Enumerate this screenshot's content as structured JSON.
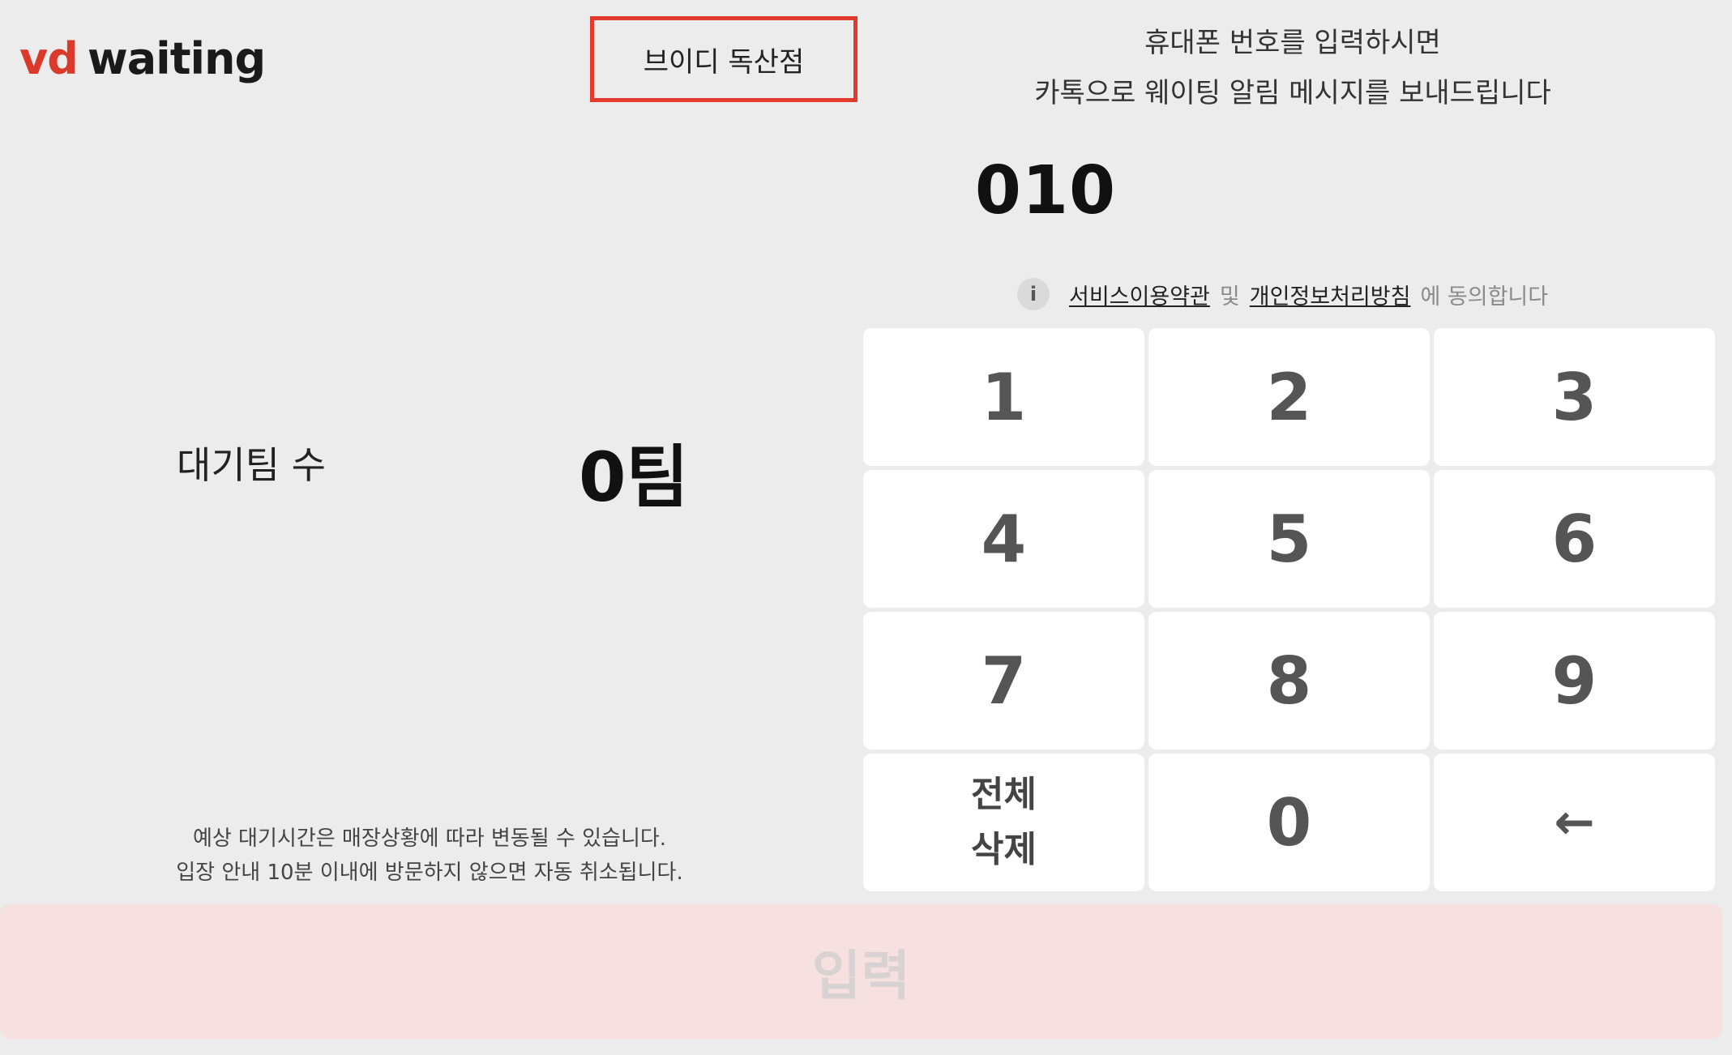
{
  "logo": {
    "brand_prefix": "vd",
    "brand_name": "waiting"
  },
  "store": {
    "name": "브이디 독산점"
  },
  "instructions": {
    "line1": "휴대폰 번호를 입력하시면",
    "line2": "카톡으로 웨이팅 알림 메시지를 보내드립니다"
  },
  "phone_input": {
    "value": "010"
  },
  "agreement": {
    "info_icon_glyph": "i",
    "terms_label": "서비스이용약관",
    "and_label": "및",
    "privacy_label": "개인정보처리방침",
    "suffix": "에 동의합니다"
  },
  "waiting": {
    "label": "대기팀 수",
    "count": "0팀"
  },
  "notice": {
    "line1": "예상 대기시간은 매장상황에 따라 변동될 수 있습니다.",
    "line2": "입장 안내 10분 이내에 방문하지 않으면 자동 취소됩니다."
  },
  "keypad": {
    "keys": [
      "1",
      "2",
      "3",
      "4",
      "5",
      "6",
      "7",
      "8",
      "9"
    ],
    "clear_line1": "전체",
    "clear_line2": "삭제",
    "zero": "0",
    "backspace": "←"
  },
  "submit": {
    "label": "입력"
  },
  "colors": {
    "background": "#ececec",
    "brand_red": "#d93a2b",
    "store_border": "#e23a2c",
    "submit_disabled_bg": "#f6e0e0"
  }
}
